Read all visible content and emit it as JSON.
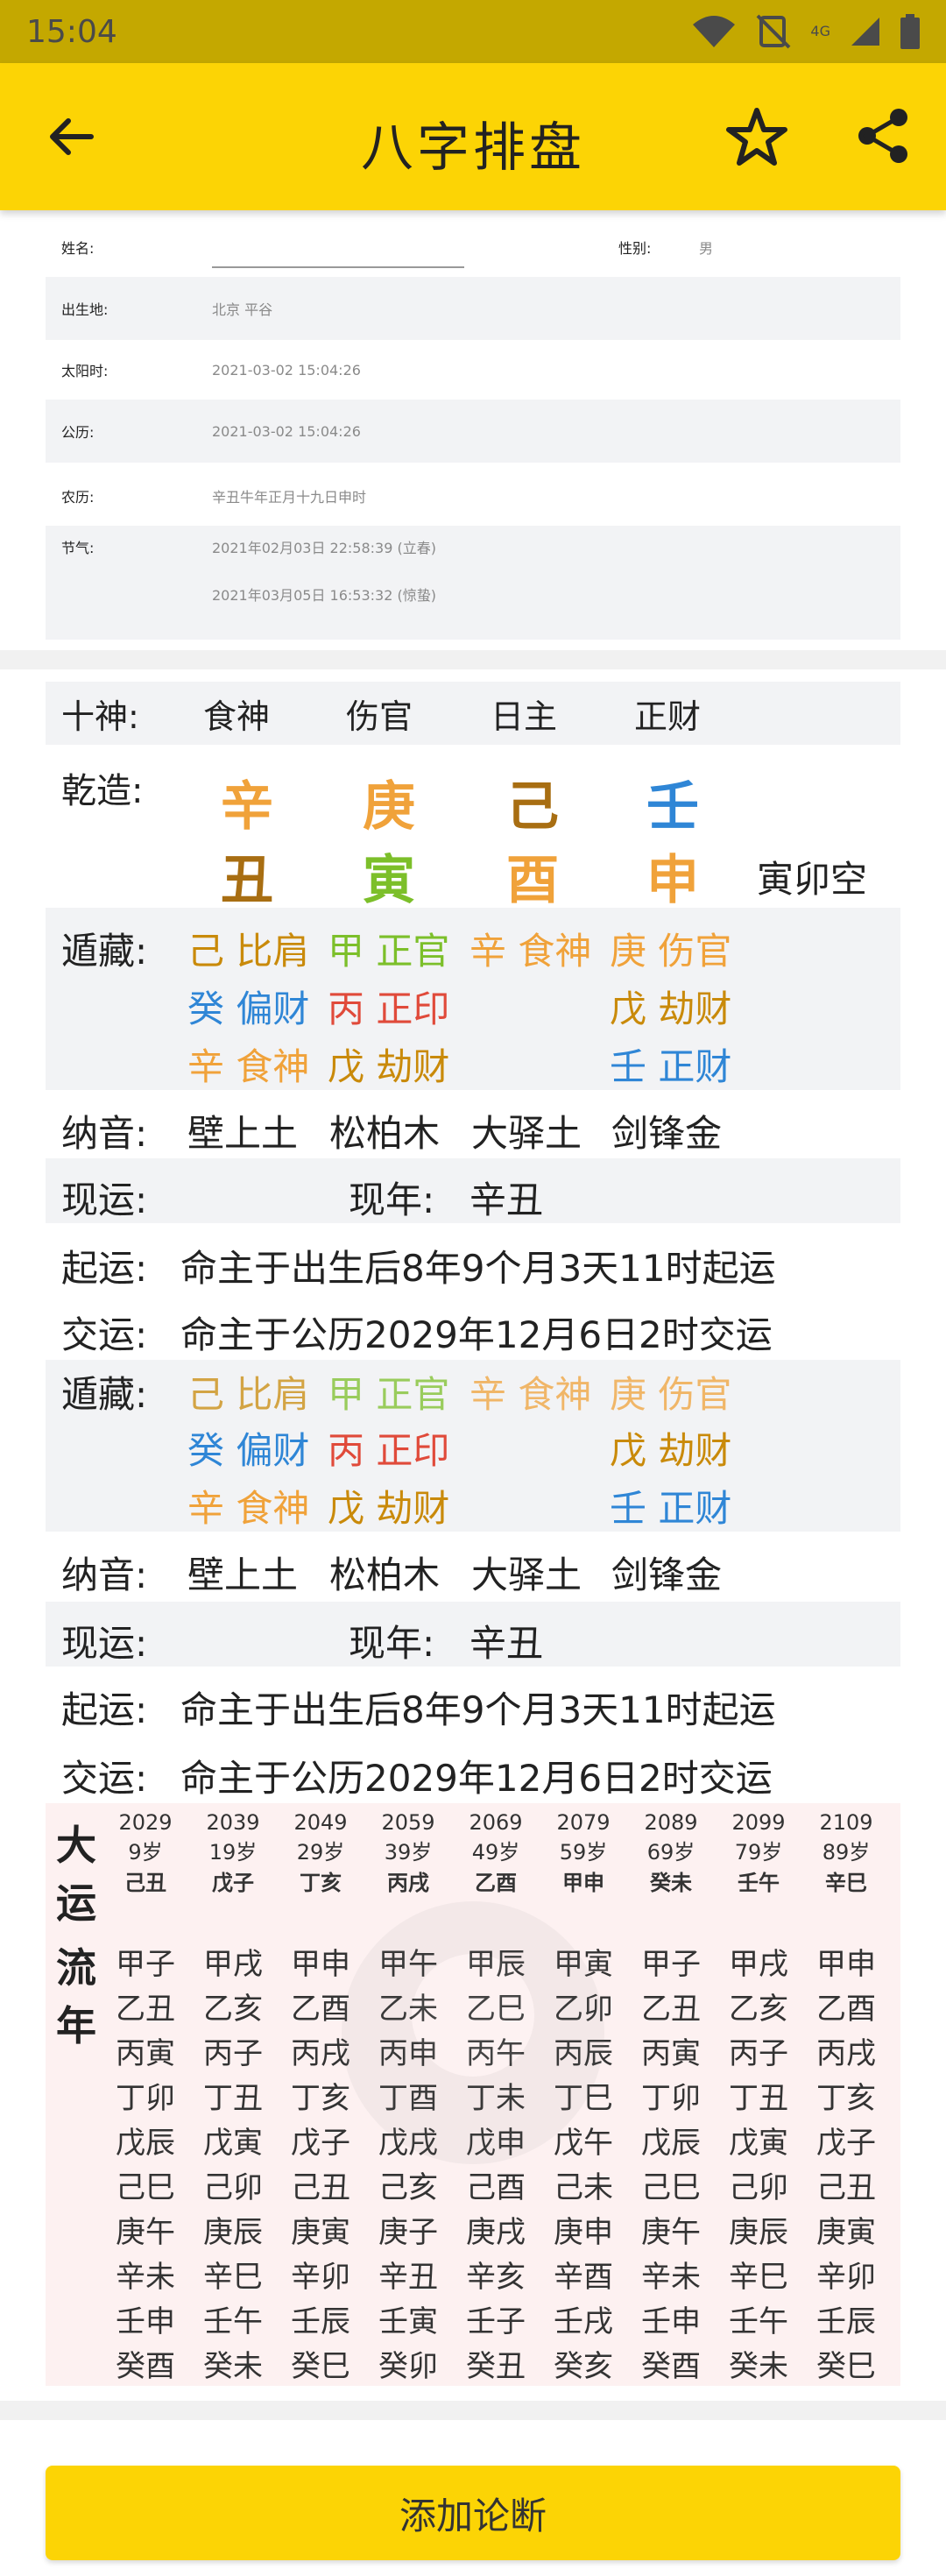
{
  "status_bar": {
    "time": "15:04",
    "network": "4G"
  },
  "app_bar": {
    "title": "八字排盘",
    "back_icon": "arrow-left-icon",
    "star_icon": "star-icon",
    "share_icon": "share-icon"
  },
  "info": {
    "name_label": "姓名:",
    "name_value": "",
    "gender_label": "性别:",
    "gender_value": "男",
    "birthplace_label": "出生地:",
    "birthplace_value": "北京 平谷",
    "solar_time_label": "太阳时:",
    "solar_time_value": "2021-03-02 15:04:26",
    "gregorian_label": "公历:",
    "gregorian_value": "2021-03-02 15:04:26",
    "lunar_label": "农历:",
    "lunar_value": "辛丑牛年正月十九日申时",
    "solar_term_label": "节气:",
    "solar_term_1": "2021年02月03日 22:58:39 (立春)",
    "solar_term_2": "2021年03月05日 16:53:32 (惊蛰)"
  },
  "chart": {
    "shishen_label": "十神:",
    "shishen": [
      "食神",
      "伤官",
      "日主",
      "正财"
    ],
    "qianzao_label": "乾造:",
    "stems": [
      "辛",
      "庚",
      "己",
      "壬"
    ],
    "branches": [
      "丑",
      "寅",
      "酉",
      "申"
    ],
    "kong": "寅卯空",
    "dunzang_label": "遁藏:",
    "hidden": [
      [
        "己 比肩",
        "甲 正官",
        "辛 食神",
        "庚 伤官"
      ],
      [
        "癸 偏财",
        "丙 正印",
        "戊 劫财"
      ],
      [
        "辛 食神",
        "戊 劫财",
        "壬 正财"
      ]
    ],
    "nayin_label": "纳音:",
    "nayin": [
      "壁上土",
      "松柏木",
      "大驿土",
      "剑锋金"
    ],
    "xianyun_label": "现运:",
    "xiannian_label": "现年:",
    "xiannian_value": "辛丑",
    "qiyun_label": "起运:",
    "qiyun_value": "命主于出生后8年9个月3天11时起运",
    "jiaoyun_label": "交运:",
    "jiaoyun_value": "命主于公历2029年12月6日2时交运"
  },
  "dayun": {
    "label_chars": [
      "大",
      "运"
    ],
    "liunian_chars": [
      "流",
      "年"
    ],
    "years": [
      "2029",
      "2039",
      "2049",
      "2059",
      "2069",
      "2079",
      "2089",
      "2099",
      "2109"
    ],
    "ages": [
      "9岁",
      "19岁",
      "29岁",
      "39岁",
      "49岁",
      "59岁",
      "69岁",
      "79岁",
      "89岁"
    ],
    "ganzhi": [
      "己丑",
      "戊子",
      "丁亥",
      "丙戌",
      "乙酉",
      "甲申",
      "癸未",
      "壬午",
      "辛巳"
    ],
    "liunian": [
      [
        "甲子",
        "乙丑",
        "丙寅",
        "丁卯",
        "戊辰",
        "己巳",
        "庚午",
        "辛未",
        "壬申",
        "癸酉"
      ],
      [
        "甲戌",
        "乙亥",
        "丙子",
        "丁丑",
        "戊寅",
        "己卯",
        "庚辰",
        "辛巳",
        "壬午",
        "癸未"
      ],
      [
        "甲申",
        "乙酉",
        "丙戌",
        "丁亥",
        "戊子",
        "己丑",
        "庚寅",
        "辛卯",
        "壬辰",
        "癸巳"
      ],
      [
        "甲午",
        "乙未",
        "丙申",
        "丁酉",
        "戊戌",
        "己亥",
        "庚子",
        "辛丑",
        "壬寅",
        "癸卯"
      ],
      [
        "甲辰",
        "乙巳",
        "丙午",
        "丁未",
        "戊申",
        "己酉",
        "庚戌",
        "辛亥",
        "壬子",
        "癸丑"
      ],
      [
        "甲寅",
        "乙卯",
        "丙辰",
        "丁巳",
        "戊午",
        "己未",
        "庚申",
        "辛酉",
        "壬戌",
        "癸亥"
      ],
      [
        "甲子",
        "乙丑",
        "丙寅",
        "丁卯",
        "戊辰",
        "己巳",
        "庚午",
        "辛未",
        "壬申",
        "癸酉"
      ],
      [
        "甲戌",
        "乙亥",
        "丙子",
        "丁丑",
        "戊寅",
        "己卯",
        "庚辰",
        "辛巳",
        "壬午",
        "癸未"
      ],
      [
        "甲申",
        "乙酉",
        "丙戌",
        "丁亥",
        "戊子",
        "己丑",
        "庚寅",
        "辛卯",
        "壬辰",
        "癸巳"
      ]
    ]
  },
  "button": {
    "add_label": "添加论断"
  }
}
